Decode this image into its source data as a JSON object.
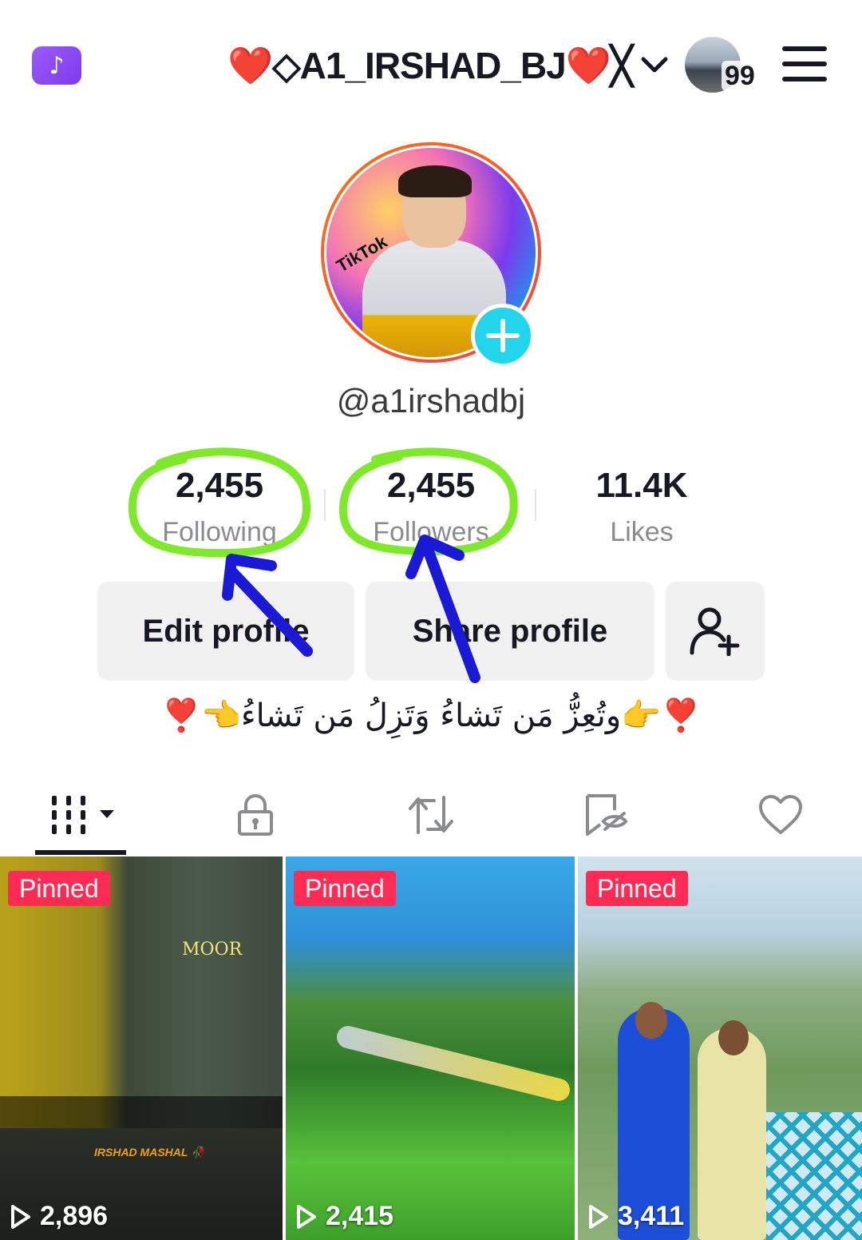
{
  "header": {
    "title": "❤️◇A1_IRSHAD_BJ❤️╳",
    "notification_count": "99"
  },
  "profile": {
    "username": "@a1irshadbj",
    "stats": [
      {
        "value": "2,455",
        "label": "Following"
      },
      {
        "value": "2,455",
        "label": "Followers"
      },
      {
        "value": "11.4K",
        "label": "Likes"
      }
    ],
    "bio": "❣️👈وتُعِزُّ مَن تَشاءُ وَتَزِلُ مَن تَشاءُ👉❣️",
    "picture_text": "TikTok"
  },
  "actions": {
    "edit_profile": "Edit profile",
    "share_profile": "Share profile"
  },
  "tabs": [
    "videos-tab",
    "private-tab",
    "reposts-tab",
    "favorites-tab",
    "liked-tab"
  ],
  "videos": [
    {
      "pinned_label": "Pinned",
      "views": "2,896",
      "caption_top": "MOOR",
      "caption_bottom": "IRSHAD MASHAL 🥀"
    },
    {
      "pinned_label": "Pinned",
      "views": "2,415"
    },
    {
      "pinned_label": "Pinned",
      "views": "3,411"
    }
  ],
  "colors": {
    "accent_red": "#fe2c55",
    "add_button": "#20d5ec",
    "highlight_green": "#7ee82a",
    "arrow_blue": "#1a1ad6"
  }
}
